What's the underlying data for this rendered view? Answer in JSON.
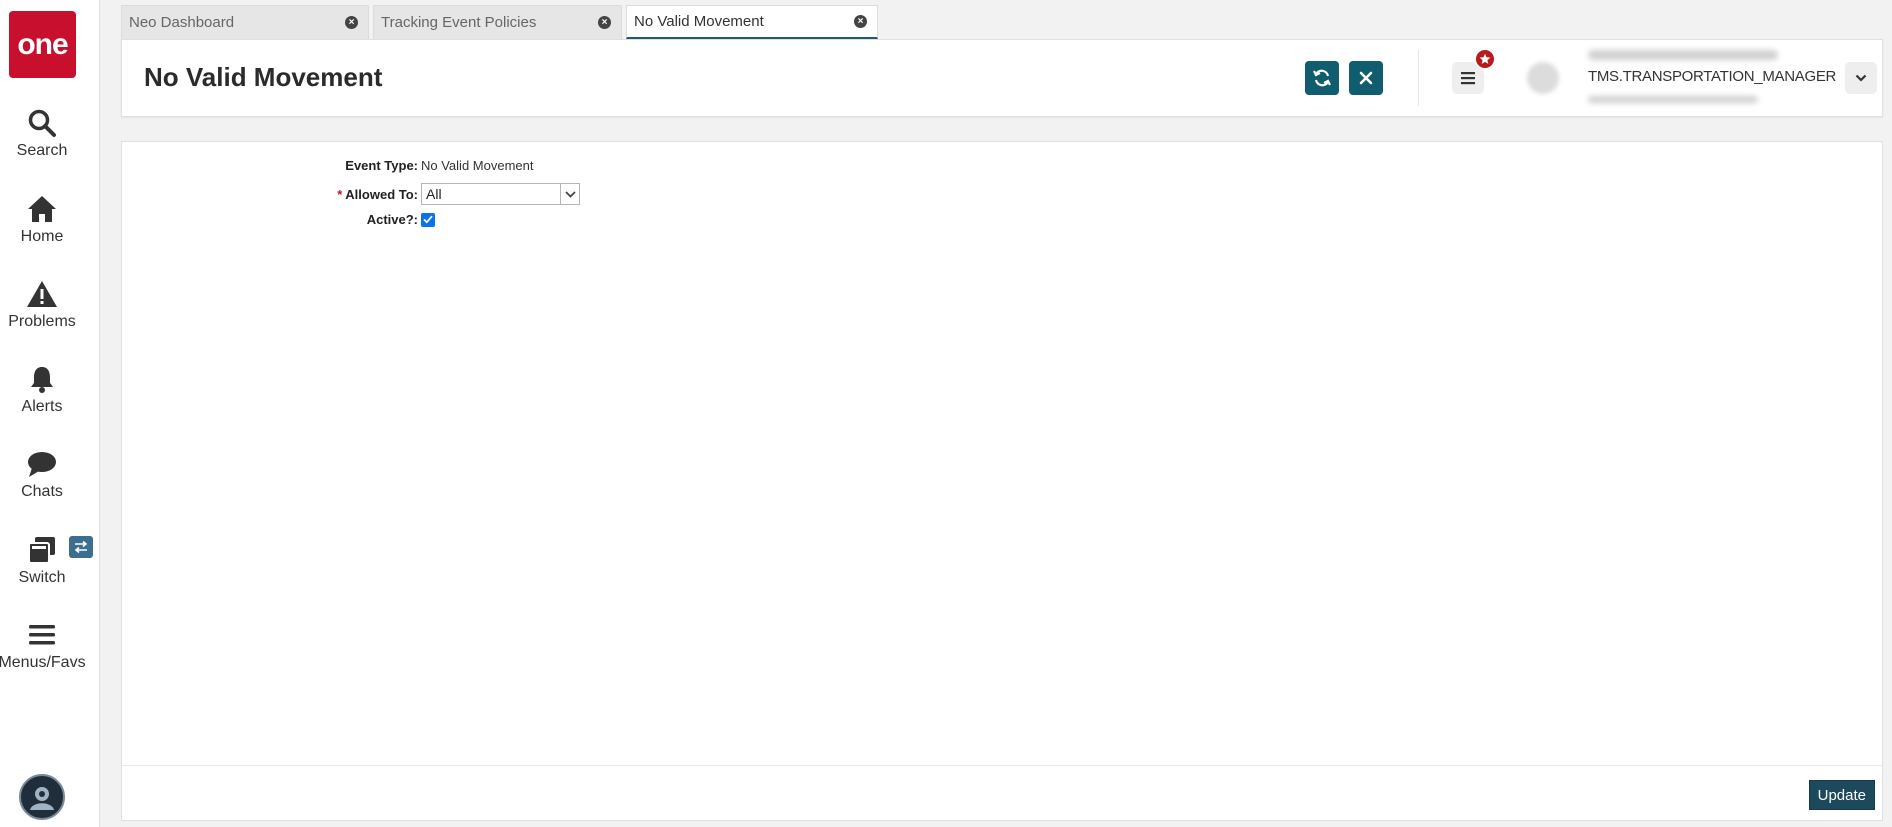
{
  "brand": {
    "logo_text": "one",
    "accent": "#c8102e",
    "primary": "#0f5d6f"
  },
  "nav": {
    "items": [
      {
        "label": "Search",
        "icon": "search-icon"
      },
      {
        "label": "Home",
        "icon": "home-icon"
      },
      {
        "label": "Problems",
        "icon": "warning-icon"
      },
      {
        "label": "Alerts",
        "icon": "bell-icon"
      },
      {
        "label": "Chats",
        "icon": "chat-icon"
      },
      {
        "label": "Switch",
        "icon": "switch-icon"
      },
      {
        "label": "Menus/Favs",
        "icon": "hamburger-icon"
      }
    ]
  },
  "tabs": [
    {
      "label": "Neo Dashboard"
    },
    {
      "label": "Tracking Event Policies"
    },
    {
      "label": "No Valid Movement"
    }
  ],
  "header": {
    "title": "No Valid Movement",
    "user_role": "TMS.TRANSPORTATION_MANAGER"
  },
  "form": {
    "event_type_label": "Event Type:",
    "event_type_value": "No Valid Movement",
    "allowed_to_label": "Allowed To:",
    "allowed_to_required": "*",
    "allowed_to_value": "All",
    "active_label": "Active?:",
    "active_checked": true
  },
  "footer": {
    "update_label": "Update"
  }
}
